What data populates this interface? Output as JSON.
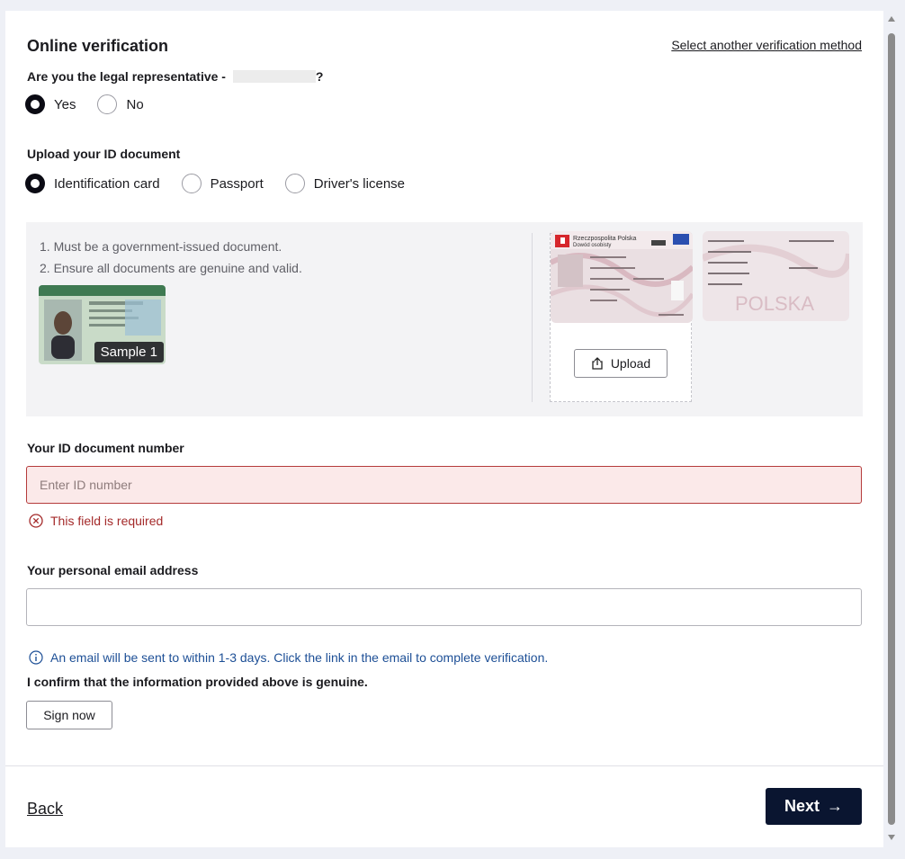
{
  "header": {
    "title": "Online verification",
    "alt_method_link": "Select another verification method"
  },
  "representative": {
    "question": "Are you the legal representative - ",
    "question_end": "?",
    "options": [
      "Yes",
      "No"
    ],
    "selected": "Yes"
  },
  "document": {
    "label": "Upload your ID document",
    "options": [
      "Identification card",
      "Passport",
      "Driver's license"
    ],
    "selected": "Identification card"
  },
  "upload_panel": {
    "requirements": [
      "1. Must be a government-issued document.",
      "2. Ensure all documents are genuine and valid."
    ],
    "sample_label": "Sample 1",
    "id_front_text": "Rzeczpospolita Polska",
    "id_front_sub": "Dowód osobisty",
    "id_back_text": "POLSKA",
    "upload_label": "Upload"
  },
  "id_number": {
    "label": "Your ID document number",
    "placeholder": "Enter ID number",
    "value": "",
    "error": "This field is required"
  },
  "email": {
    "label": "Your personal email address",
    "value": ""
  },
  "info_message": "An email will be sent to within 1-3 days. Click the link in the email to complete verification.",
  "confirm_text": "I confirm that the information provided above is genuine.",
  "sign_button": "Sign now",
  "footer": {
    "back": "Back",
    "next": "Next"
  },
  "colors": {
    "primary": "#0a1530",
    "error": "#a42a2a",
    "error_bg": "#fbe9e9",
    "info": "#1d4f96",
    "panel_bg": "#f3f3f5"
  },
  "icons": {
    "upload": "upload-icon",
    "error": "error-circle-x-icon",
    "info": "info-circle-icon",
    "next": "arrow-right-icon"
  }
}
